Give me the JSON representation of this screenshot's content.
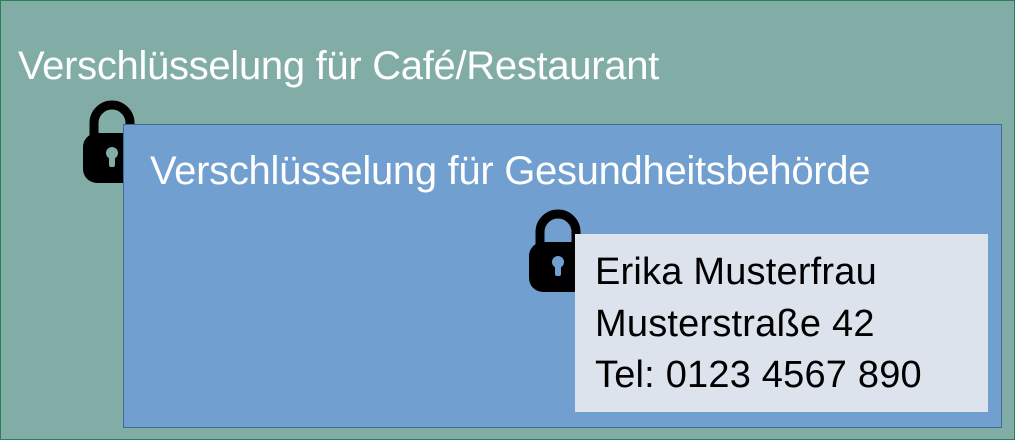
{
  "outer_box": {
    "title": "Verschlüsselung für Café/Restaurant",
    "lock_icon": "lock-icon"
  },
  "inner_box": {
    "title": "Verschlüsselung für Gesundheitsbehörde",
    "lock_icon": "lock-icon"
  },
  "contact_card": {
    "name": "Erika Musterfrau",
    "street": "Musterstraße 42",
    "phone": "Tel: 0123 4567 890"
  },
  "colors": {
    "outer_background": "#82ada6",
    "inner_background": "#719fd0",
    "card_background": "#dce3ed",
    "lock": "#000000"
  }
}
